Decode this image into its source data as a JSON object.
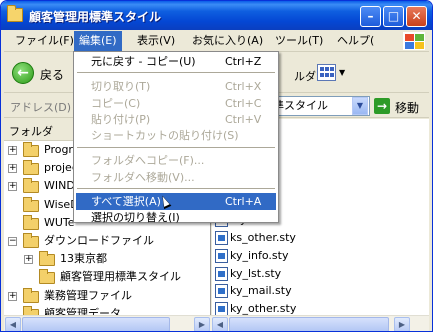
{
  "window": {
    "title": "顧客管理用標準スタイル",
    "minimize_glyph": "–",
    "maximize_glyph": "□",
    "close_glyph": "✕"
  },
  "menubar": {
    "items": [
      {
        "label": "ファイル(F)"
      },
      {
        "label": "編集(E)",
        "active": true
      },
      {
        "label": "表示(V)"
      },
      {
        "label": "お気に入り(A)"
      },
      {
        "label": "ツール(T)"
      },
      {
        "label": "ヘルプ("
      }
    ]
  },
  "toolbar": {
    "back_label": "戻る",
    "folder_label": "ルダ"
  },
  "addressbar": {
    "label": "アドレス(D)",
    "value": "準スタイル",
    "go_label": "移動"
  },
  "folder_panel": {
    "title": "フォルダ",
    "items": [
      {
        "label": "Progra",
        "expander": "+"
      },
      {
        "label": "projec",
        "expander": "+"
      },
      {
        "label": "WINDO",
        "expander": "+"
      },
      {
        "label": "WiseD",
        "expander": ""
      },
      {
        "label": "WUTe",
        "expander": ""
      },
      {
        "label": "ダウンロードファイル",
        "expander": "−"
      },
      {
        "label": "13東京都",
        "expander": "+"
      },
      {
        "label": "顧客管理用標準スタイル",
        "expander": ""
      },
      {
        "label": "業務管理ファイル",
        "expander": "+"
      },
      {
        "label": "顧客管理データ",
        "expander": ""
      }
    ]
  },
  "file_list": {
    "items": [
      {
        "label": "sty"
      },
      {
        "label": "sty"
      },
      {
        "label": "sty"
      },
      {
        "label": "sty"
      },
      {
        "label": "sty"
      },
      {
        "label": "ks_other.sty"
      },
      {
        "label": "ky_info.sty"
      },
      {
        "label": "ky_lst.sty"
      },
      {
        "label": "ky_mail.sty"
      },
      {
        "label": "ky_other.sty"
      }
    ]
  },
  "edit_menu": {
    "items": [
      {
        "label": "元に戻す - コピー(U)",
        "shortcut": "Ctrl+Z",
        "disabled": false
      },
      {
        "label": "切り取り(T)",
        "shortcut": "Ctrl+X",
        "disabled": true
      },
      {
        "label": "コピー(C)",
        "shortcut": "Ctrl+C",
        "disabled": true
      },
      {
        "label": "貼り付け(P)",
        "shortcut": "Ctrl+V",
        "disabled": true
      },
      {
        "label": "ショートカットの貼り付け(S)",
        "shortcut": "",
        "disabled": true
      },
      {
        "label": "フォルダへコピー(F)...",
        "shortcut": "",
        "disabled": true
      },
      {
        "label": "フォルダへ移動(V)...",
        "shortcut": "",
        "disabled": true
      },
      {
        "label": "すべて選択(A)",
        "shortcut": "Ctrl+A",
        "disabled": false,
        "highlighted": true
      },
      {
        "label": "選択の切り替え(I)",
        "shortcut": "",
        "disabled": false
      }
    ]
  },
  "colors": {
    "titlebar": "#0a5ce8",
    "menu_highlight": "#316ac5",
    "disabled_text": "#aca899",
    "window_face": "#ece9d8"
  }
}
